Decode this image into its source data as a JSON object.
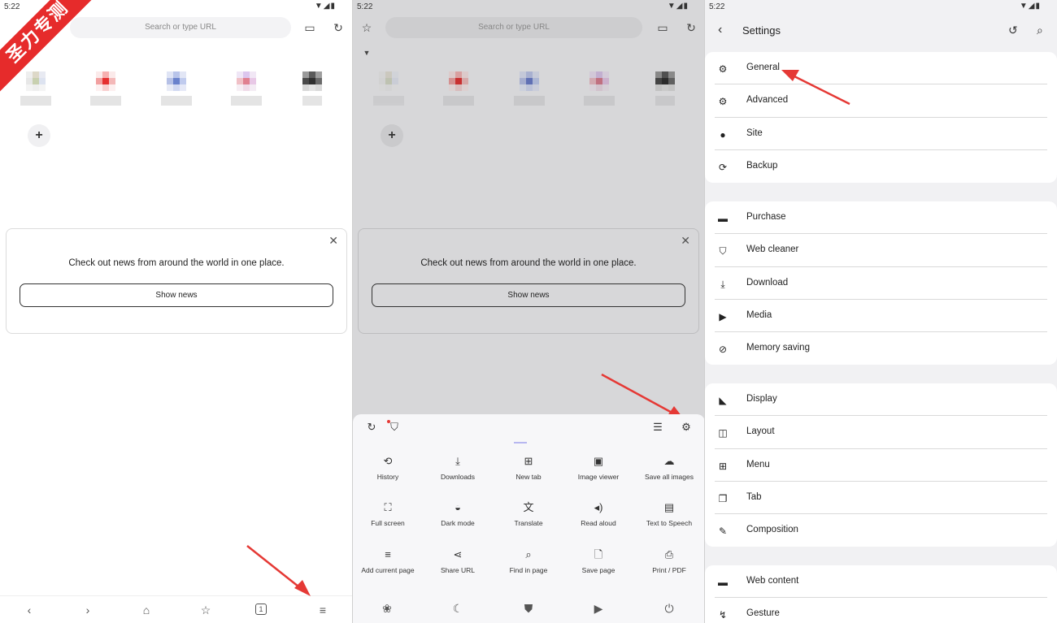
{
  "status": {
    "time": "5:22",
    "icons": "▼◢▮"
  },
  "watermark": "圣力专测",
  "browser": {
    "search_placeholder": "Search or type URL",
    "news_message": "Check out news from around the world in one place.",
    "show_news": "Show news",
    "tab_count": "1"
  },
  "menu": {
    "items": [
      {
        "label": "History",
        "icon": "history-icon"
      },
      {
        "label": "Downloads",
        "icon": "download-icon"
      },
      {
        "label": "New tab",
        "icon": "new-tab-icon"
      },
      {
        "label": "Image viewer",
        "icon": "image-viewer-icon"
      },
      {
        "label": "Save all images",
        "icon": "cloud-download-icon"
      },
      {
        "label": "Full screen",
        "icon": "fullscreen-icon"
      },
      {
        "label": "Dark mode",
        "icon": "dark-mode-icon"
      },
      {
        "label": "Translate",
        "icon": "translate-icon"
      },
      {
        "label": "Read aloud",
        "icon": "read-aloud-icon"
      },
      {
        "label": "Text to Speech",
        "icon": "tts-icon"
      },
      {
        "label": "Add current page",
        "icon": "add-page-icon"
      },
      {
        "label": "Share URL",
        "icon": "share-icon"
      },
      {
        "label": "Find in page",
        "icon": "find-icon"
      },
      {
        "label": "Save page",
        "icon": "save-page-icon"
      },
      {
        "label": "Print / PDF",
        "icon": "print-icon"
      }
    ]
  },
  "settings": {
    "title": "Settings",
    "groups": [
      [
        "General",
        "Advanced",
        "Site",
        "Backup"
      ],
      [
        "Purchase",
        "Web cleaner",
        "Download",
        "Media",
        "Memory saving"
      ],
      [
        "Display",
        "Layout",
        "Menu",
        "Tab",
        "Composition"
      ],
      [
        "Web content",
        "Gesture"
      ]
    ]
  },
  "colors": {
    "accent_red": "#e62b2b",
    "annotation_arrow": "#e53935"
  }
}
